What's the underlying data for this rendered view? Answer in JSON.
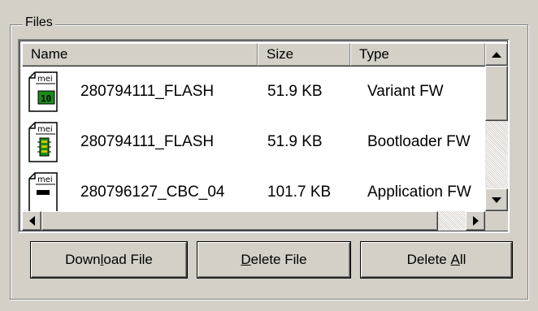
{
  "group": {
    "title": "Files"
  },
  "list": {
    "columns": [
      "Name",
      "Size",
      "Type"
    ],
    "rows": [
      {
        "name": "280794111_FLASH",
        "size": "51.9 KB",
        "type": "Variant FW",
        "icon_label": "mei",
        "icon_glyph": "10"
      },
      {
        "name": "280794111_FLASH",
        "size": "51.9 KB",
        "type": "Bootloader FW",
        "icon_label": "mei",
        "icon_glyph": "chip"
      },
      {
        "name": "280796127_CBC_04",
        "size": "101.7 KB",
        "type": "Application FW",
        "icon_label": "mei",
        "icon_glyph": ""
      }
    ]
  },
  "buttons": {
    "download": {
      "pre": "Down",
      "key": "l",
      "post": "oad File"
    },
    "delete": {
      "pre": "",
      "key": "D",
      "post": "elete File"
    },
    "delete_all": {
      "pre": "Delete ",
      "key": "A",
      "post": "ll"
    }
  },
  "colors": {
    "face": "#d4d0c8",
    "window": "#ffffff",
    "icon_green": "#1a8a1a"
  },
  "icons": [
    "file-mei-icon",
    "scroll-up-icon",
    "scroll-down-icon",
    "scroll-left-icon",
    "scroll-right-icon"
  ]
}
